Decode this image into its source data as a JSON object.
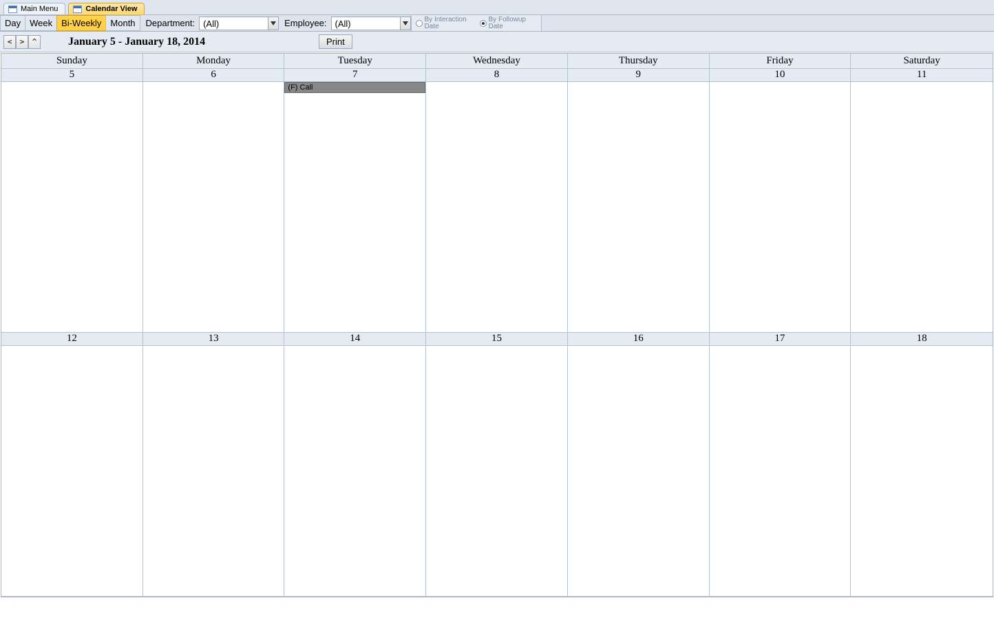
{
  "tabs": {
    "main_menu": "Main Menu",
    "calendar_view": "Calendar View"
  },
  "toolbar": {
    "view_day": "Day",
    "view_week": "Week",
    "view_biweekly": "Bi-Weekly",
    "view_month": "Month",
    "department_label": "Department:",
    "department_value": "(All)",
    "employee_label": "Employee:",
    "employee_value": "(All)",
    "radio_interaction": "By Interaction Date",
    "radio_followup": "By Followup Date"
  },
  "nav": {
    "prev": "<",
    "next": ">",
    "up": "^",
    "date_range": "January 5 - January 18, 2014",
    "print": "Print"
  },
  "calendar": {
    "day_headers": [
      "Sunday",
      "Monday",
      "Tuesday",
      "Wednesday",
      "Thursday",
      "Friday",
      "Saturday"
    ],
    "week1_dates": [
      "5",
      "6",
      "7",
      "8",
      "9",
      "10",
      "11"
    ],
    "week2_dates": [
      "12",
      "13",
      "14",
      "15",
      "16",
      "17",
      "18"
    ],
    "event_week1_day2": "(F) Call"
  }
}
